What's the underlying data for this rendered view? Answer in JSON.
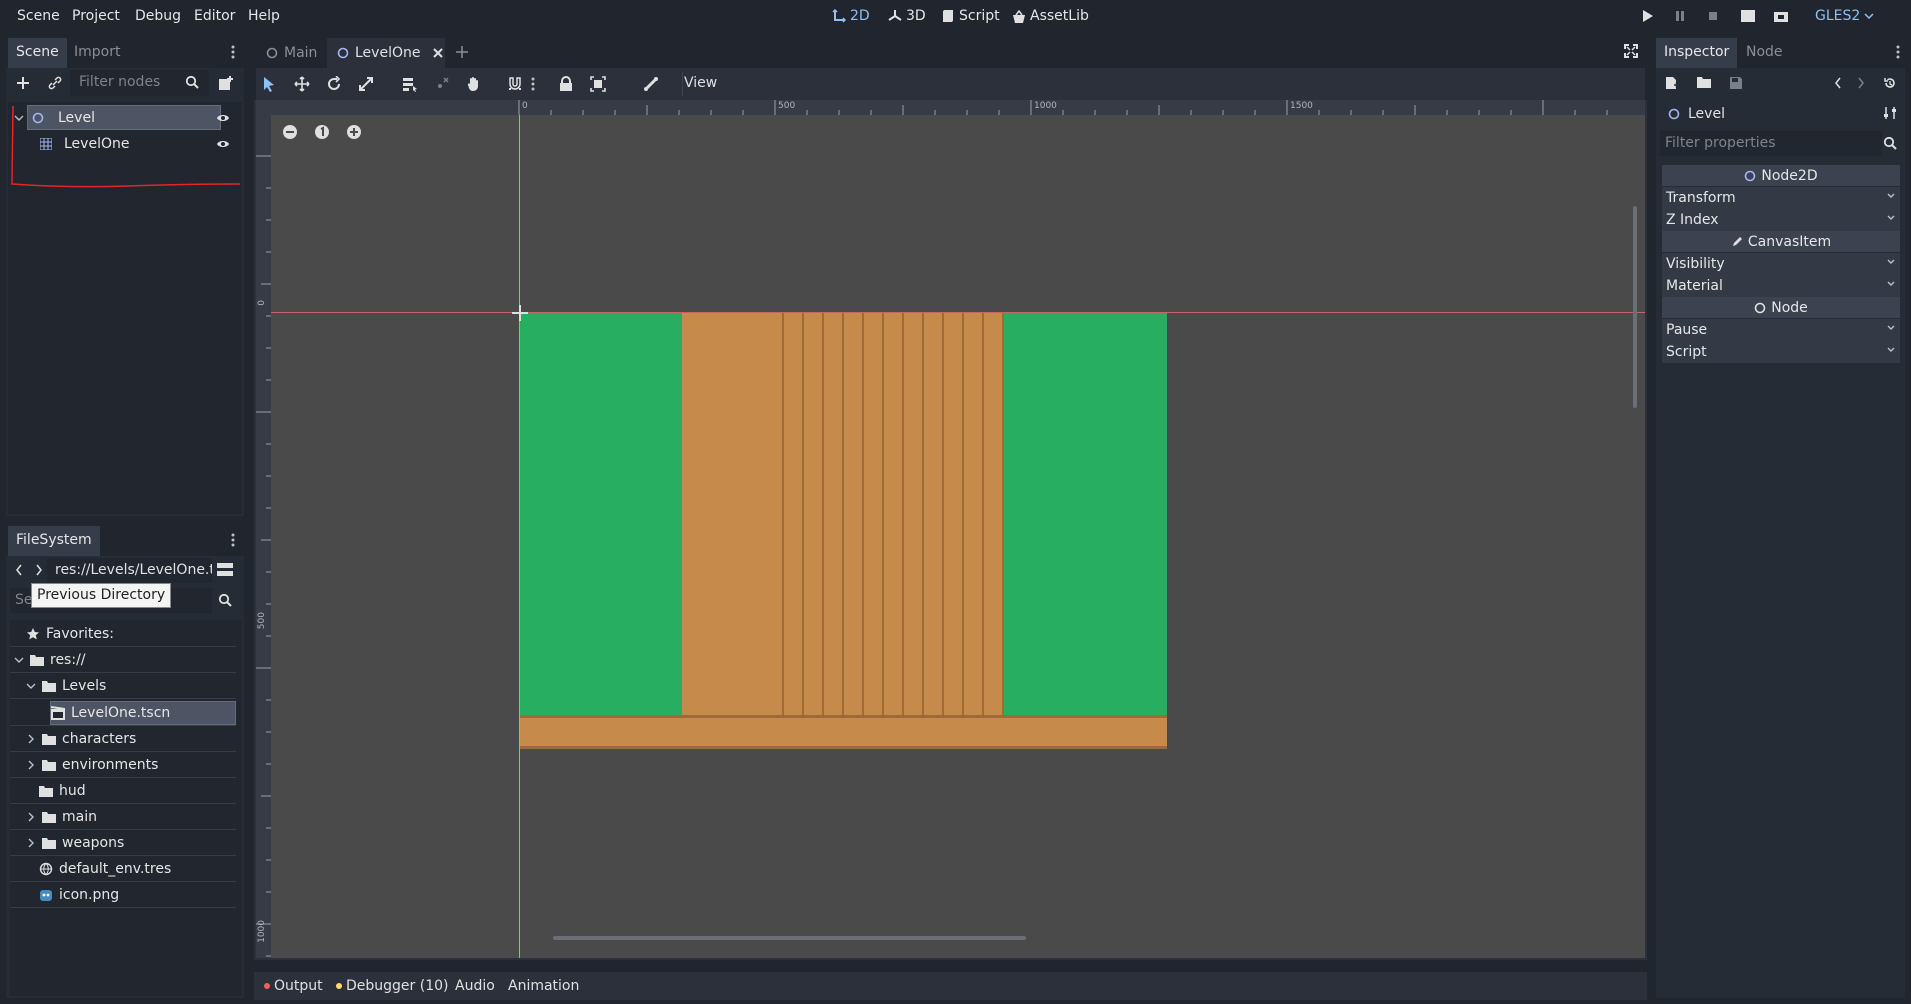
{
  "menu": [
    "Scene",
    "Project",
    "Debug",
    "Editor",
    "Help"
  ],
  "workspaces": {
    "d2": "2D",
    "d3": "3D",
    "script": "Script",
    "assetlib": "AssetLib"
  },
  "renderer": "GLES2",
  "scene_dock": {
    "tab_scene": "Scene",
    "tab_import": "Import",
    "filter_placeholder": "Filter nodes",
    "nodes": [
      {
        "label": "Level"
      },
      {
        "label": "LevelOne"
      }
    ]
  },
  "editor_tabs": [
    {
      "label": "Main"
    },
    {
      "label": "LevelOne"
    }
  ],
  "toolbar": {
    "view_label": "View"
  },
  "ruler": {
    "h_labels": [
      "0",
      "500",
      "1000",
      "1500"
    ],
    "v_labels": [
      "0",
      "500",
      "1000"
    ]
  },
  "filesystem": {
    "title": "FileSystem",
    "path": "res://Levels/LevelOne.t",
    "search_placeholder": "Se",
    "tooltip": "Previous Directory",
    "items": [
      {
        "label": "Favorites:"
      },
      {
        "label": "res://"
      },
      {
        "label": "Levels"
      },
      {
        "label": "LevelOne.tscn"
      },
      {
        "label": "characters"
      },
      {
        "label": "environments"
      },
      {
        "label": "hud"
      },
      {
        "label": "main"
      },
      {
        "label": "weapons"
      },
      {
        "label": "default_env.tres"
      },
      {
        "label": "icon.png"
      }
    ]
  },
  "inspector": {
    "tab_inspector": "Inspector",
    "tab_node": "Node",
    "object": "Level",
    "filter_placeholder": "Filter properties",
    "sections": {
      "node2d": "Node2D",
      "canvasitem": "CanvasItem",
      "node": "Node"
    },
    "rows": {
      "transform": "Transform",
      "zindex": "Z Index",
      "visibility": "Visibility",
      "material": "Material",
      "pause": "Pause",
      "script": "Script"
    }
  },
  "bottom_panel": {
    "output": "Output",
    "debugger": "Debugger (10)",
    "audio": "Audio",
    "animation": "Animation"
  },
  "colors": {
    "accent": "#8ec0f5",
    "grass": "#27ae60",
    "dirt": "#c68a4b",
    "error": "#ff5d5d",
    "warning": "#ffdd65"
  }
}
